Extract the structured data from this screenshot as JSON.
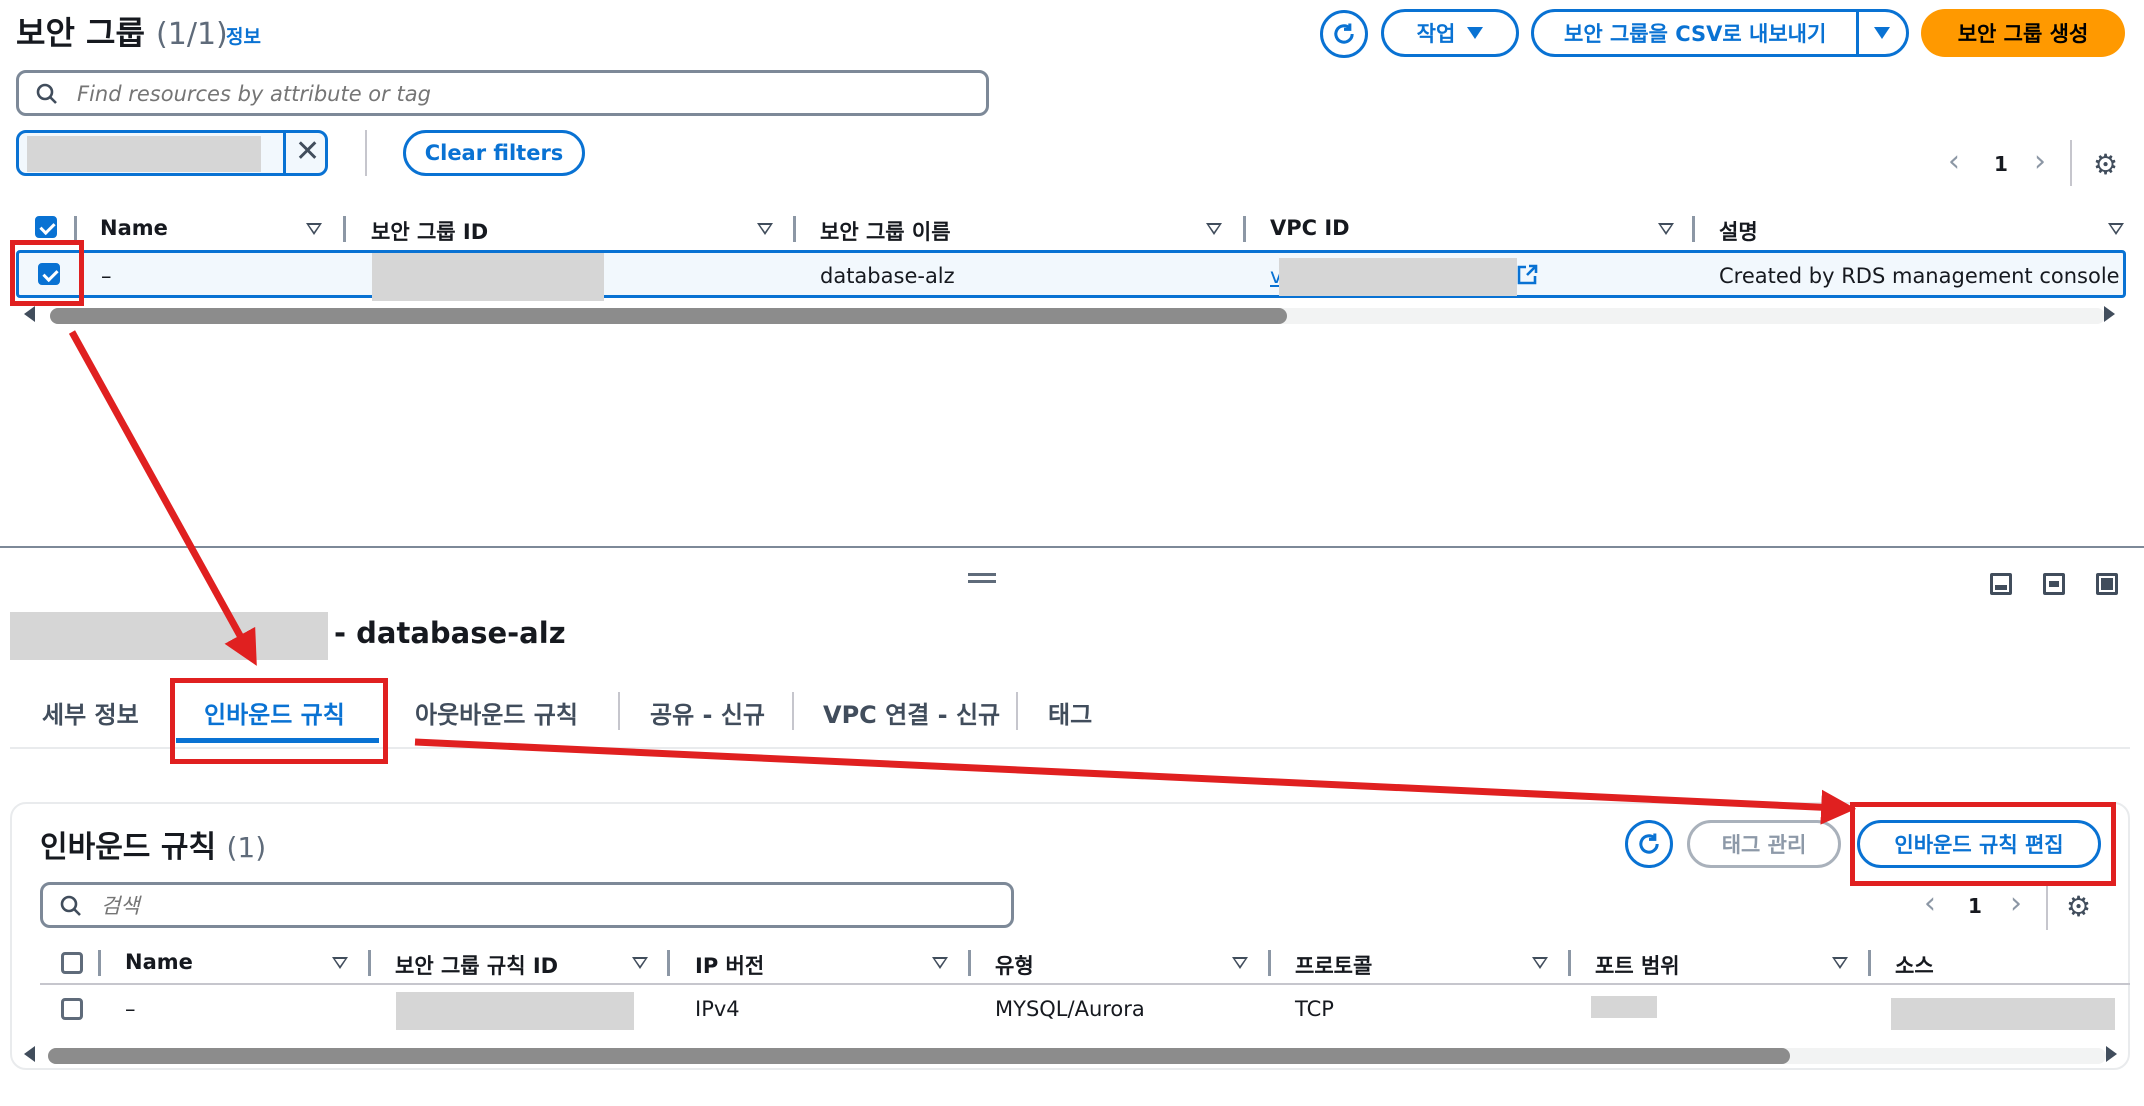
{
  "header": {
    "title": "보안 그룹",
    "count": "(1/1)",
    "info_link": "정보",
    "actions_label": "작업",
    "export_label": "보안 그룹을 CSV로 내보내기",
    "create_label": "보안 그룹 생성"
  },
  "search": {
    "placeholder": "Find resources by attribute or tag"
  },
  "filter": {
    "clear_label": "Clear filters"
  },
  "pagination_top": {
    "page": "1"
  },
  "sg_table": {
    "columns": [
      "Name",
      "보안 그룹 ID",
      "보안 그룹 이름",
      "VPC ID",
      "설명"
    ],
    "row": {
      "name": "–",
      "group_name": "database-alz",
      "vpc_prefix": "v",
      "description": "Created by RDS management console"
    }
  },
  "detail": {
    "title_suffix": "- database-alz",
    "tabs": [
      "세부 정보",
      "인바운드 규칙",
      "아웃바운드 규칙",
      "공유 - 신규",
      "VPC 연결 - 신규",
      "태그"
    ]
  },
  "inbound": {
    "title": "인바운드 규칙",
    "count": "(1)",
    "manage_tags_label": "태그 관리",
    "edit_label": "인바운드 규칙 편집",
    "search_placeholder": "검색",
    "page": "1",
    "columns": [
      "Name",
      "보안 그룹 규칙 ID",
      "IP 버전",
      "유형",
      "프로토콜",
      "포트 범위",
      "소스"
    ],
    "row": {
      "name": "–",
      "ip_version": "IPv4",
      "type": "MYSQL/Aurora",
      "protocol": "TCP"
    }
  },
  "colors": {
    "accent": "#0972d3",
    "primary": "#ff9900",
    "annotation": "#e02020"
  }
}
